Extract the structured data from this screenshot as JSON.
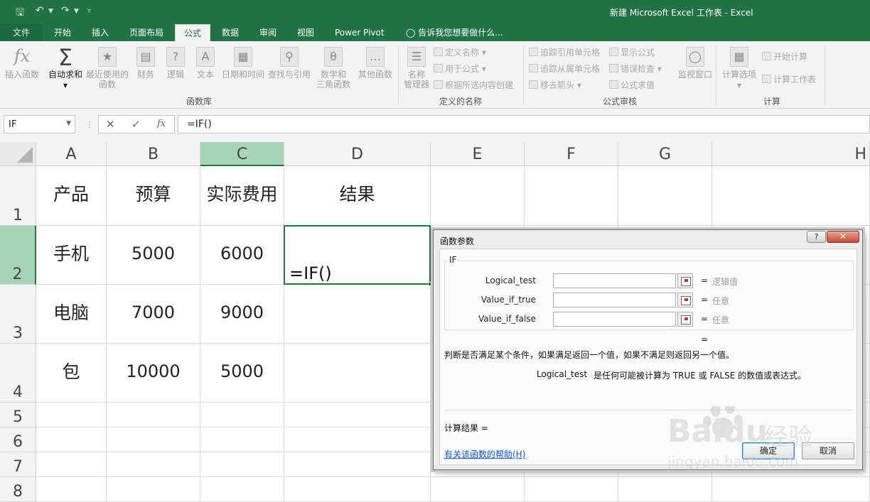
{
  "app": {
    "title": "新建 Microsoft Excel 工作表 - Excel"
  },
  "tabs": [
    "文件",
    "开始",
    "插入",
    "页面布局",
    "公式",
    "数据",
    "审阅",
    "视图",
    "Power Pivot"
  ],
  "tell_me": "告诉我您想要做什么...",
  "ribbon": {
    "insert_function": "插入函数",
    "autosum_line1": "自动求和",
    "recent_line1": "最近使用的",
    "recent_line2": "函数",
    "financial": "财务",
    "logical": "逻辑",
    "text": "文本",
    "datetime": "日期和时间",
    "lookup": "查找与引用",
    "math_line1": "数学和",
    "math_line2": "三角函数",
    "more": "其他函数",
    "group_library": "函数库",
    "name_manager_line1": "名称",
    "name_manager_line2": "管理器",
    "define_name": "定义名称",
    "use_in_formula": "用于公式",
    "create_from_selection": "根据所选内容创建",
    "group_defined_names": "定义的名称",
    "trace_precedents": "追踪引用单元格",
    "trace_dependents": "追踪从属单元格",
    "remove_arrows": "移去箭头",
    "show_formulas": "显示公式",
    "error_checking": "错误检查",
    "evaluate_formula": "公式求值",
    "watch_window": "监视窗口",
    "group_auditing": "公式审核",
    "calc_options": "计算选项",
    "calc_now": "开始计算",
    "calc_sheet": "计算工作表",
    "group_calculation": "计算"
  },
  "formula_bar": {
    "name_box": "IF",
    "cancel": "✕",
    "enter": "✓",
    "fx": "fx",
    "formula": "=IF()"
  },
  "sheet": {
    "columns": [
      "A",
      "B",
      "C",
      "D",
      "E",
      "F",
      "G",
      "H"
    ],
    "rows": [
      "1",
      "2",
      "3",
      "4",
      "5",
      "6",
      "7",
      "8"
    ],
    "cells": {
      "A1": "产品",
      "B1": "预算",
      "C1": "实际费用",
      "D1": "结果",
      "A2": "手机",
      "B2": "5000",
      "C2": "6000",
      "D2": "=IF()",
      "A3": "电脑",
      "B3": "7000",
      "C3": "9000",
      "A4": "包",
      "B4": "10000",
      "C4": "5000"
    }
  },
  "dialog": {
    "title": "函数参数",
    "help_btn": "?",
    "close_btn": "✕",
    "function_name": "IF",
    "args": [
      {
        "label": "Logical_test",
        "hint": "逻辑值"
      },
      {
        "label": "Value_if_true",
        "hint": "任意"
      },
      {
        "label": "Value_if_false",
        "hint": "任意"
      }
    ],
    "result_eq": "=",
    "description": "判断是否满足某个条件，如果满足返回一个值，如果不满足则返回另一个值。",
    "arg_name": "Logical_test",
    "arg_desc": "是任何可能被计算为 TRUE 或 FALSE 的数值或表达式。",
    "calc_result": "计算结果 =",
    "help_link": "有关该函数的帮助(H)",
    "ok": "确定",
    "cancel": "取消"
  },
  "watermark": {
    "brand": "Baidu",
    "cn": "经验",
    "url": "jingyan.baidu.com"
  },
  "colors": {
    "excel_green": "#217346",
    "selected_header": "#a6d4b7"
  }
}
